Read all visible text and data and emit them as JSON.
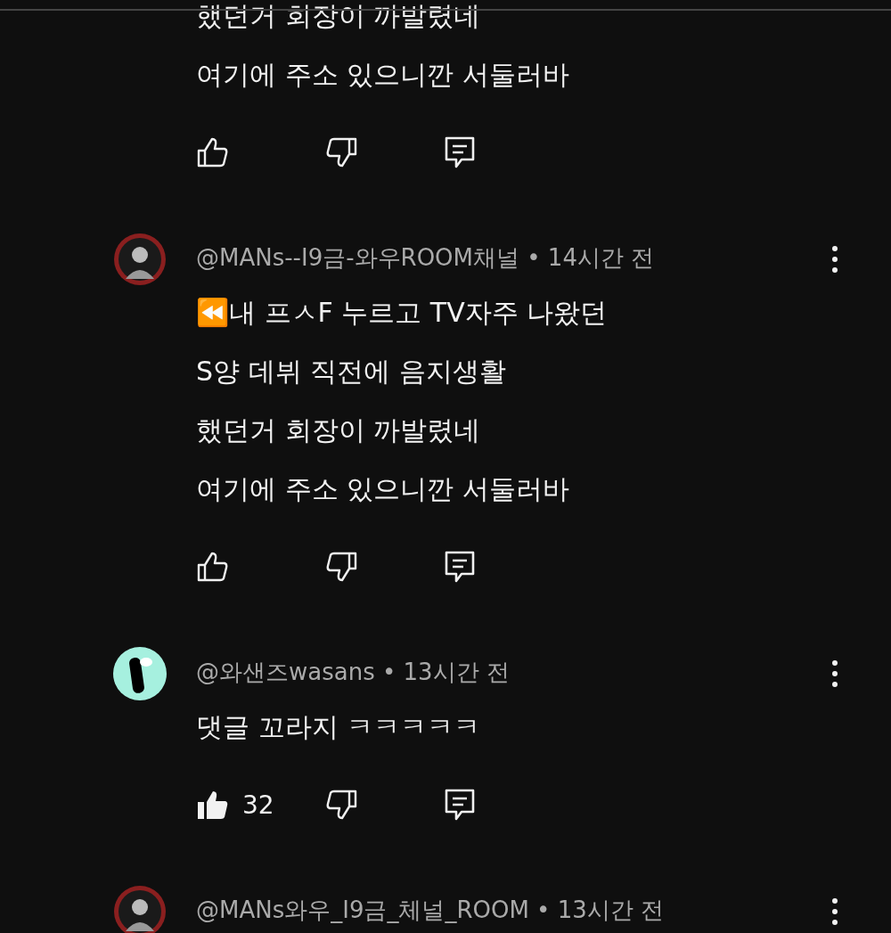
{
  "comments": [
    {
      "body_lines": [
        "했던거 회장이 까발렸네",
        "여기에 주소 있으니깐 서둘러바"
      ],
      "liked": false
    },
    {
      "avatar": {
        "kind": "portrait"
      },
      "meta": "@MANs--I9금-와우ROOM채널 • 14시간 전",
      "body_lines": [
        "⏪내 프ㅅF 누르고 TV자주 나왔던",
        "S양 데뷔 직전에 음지생활",
        "했던거 회장이 까발렸네",
        "여기에 주소 있으니깐 서둘러바"
      ],
      "liked": false
    },
    {
      "avatar": {
        "kind": "logo"
      },
      "meta": "@와샌즈wasans • 13시간 전",
      "body_lines": [
        "댓글 꼬라지 ㅋㅋㅋㅋㅋ"
      ],
      "liked": true,
      "like_count": "32"
    },
    {
      "avatar": {
        "kind": "portrait"
      },
      "meta": "@MANs와우_I9금_체널_ROOM • 13시간 전"
    }
  ]
}
